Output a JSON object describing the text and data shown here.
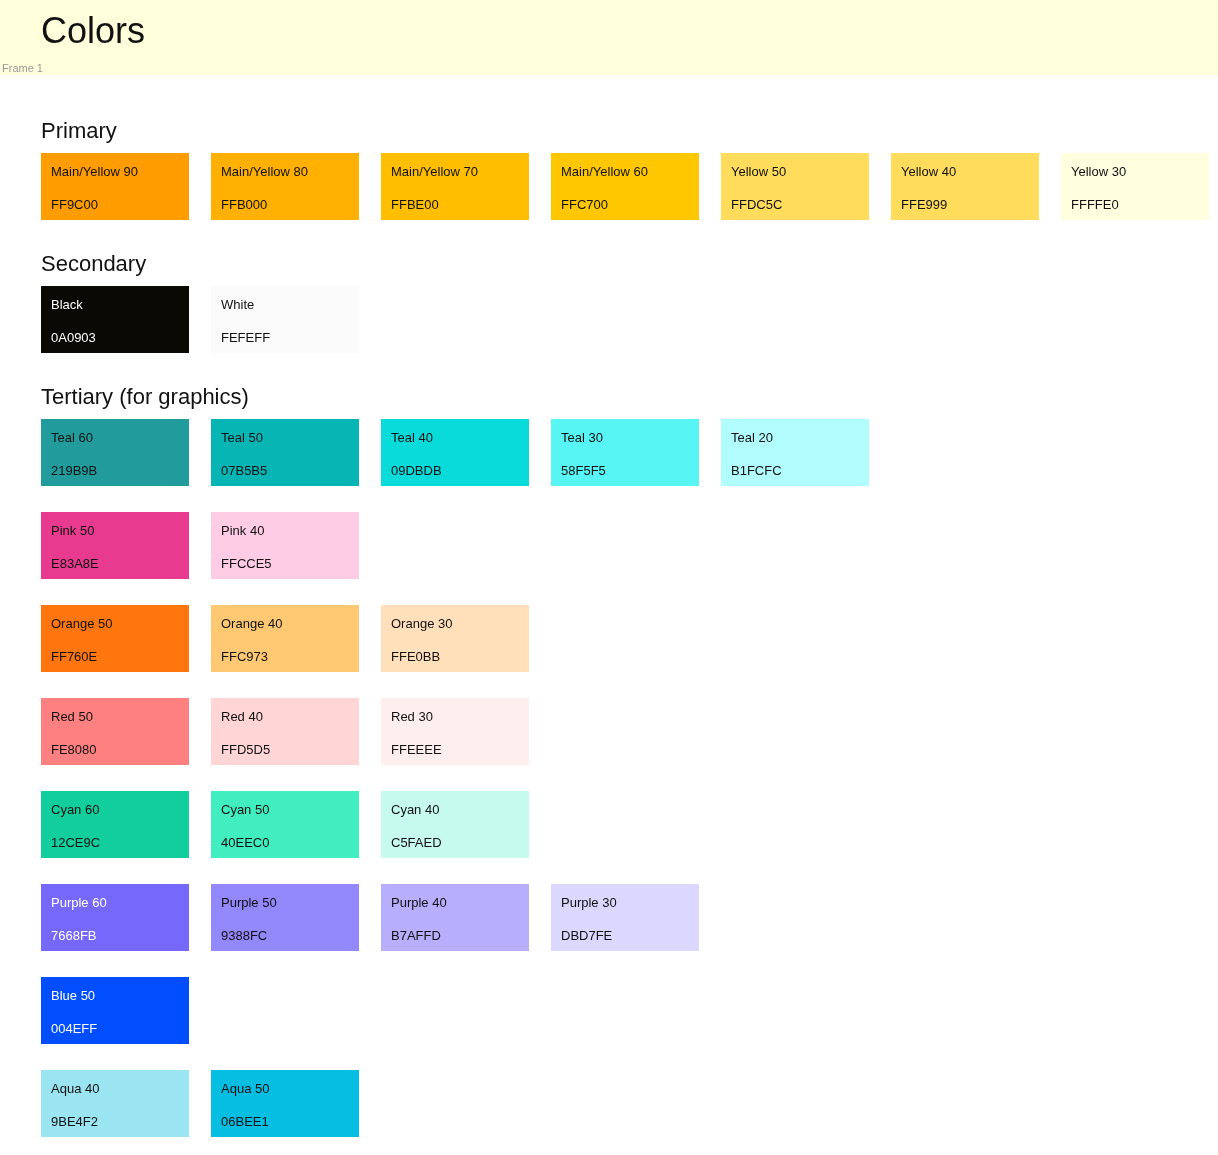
{
  "title": "Colors",
  "frame_label": "Frame 1",
  "sections": [
    {
      "heading": "Primary",
      "rows": [
        [
          {
            "name": "Main/Yellow 90",
            "hex": "FF9C00",
            "color": "#ff9c00",
            "light_text": false
          },
          {
            "name": "Main/Yellow 80",
            "hex": "FFB000",
            "color": "#ffb000",
            "light_text": false
          },
          {
            "name": "Main/Yellow 70",
            "hex": "FFBE00",
            "color": "#ffbe00",
            "light_text": false
          },
          {
            "name": "Main/Yellow 60",
            "hex": "FFC700",
            "color": "#ffc700",
            "light_text": false
          },
          {
            "name": "Yellow 50",
            "hex": "FFDC5C",
            "color": "#ffdc5c",
            "light_text": false
          },
          {
            "name": "Yellow 40",
            "hex": "FFE999",
            "color": "#ffdc5c",
            "light_text": false
          },
          {
            "name": "Yellow 30",
            "hex": "FFFFE0",
            "color": "#ffffe0",
            "light_text": false
          }
        ]
      ]
    },
    {
      "heading": "Secondary",
      "rows": [
        [
          {
            "name": "Black",
            "hex": "0A0903",
            "color": "#0a0903",
            "light_text": true
          },
          {
            "name": "White",
            "hex": "FEFEFF",
            "color": "#fafafa",
            "light_text": false
          }
        ]
      ]
    },
    {
      "heading": "Tertiary (for graphics)",
      "rows": [
        [
          {
            "name": "Teal 60",
            "hex": "219B9B",
            "color": "#219b9b",
            "light_text": false
          },
          {
            "name": "Teal 50",
            "hex": "07B5B5",
            "color": "#07b5b5",
            "light_text": false
          },
          {
            "name": "Teal 40",
            "hex": "09DBDB",
            "color": "#09dbdb",
            "light_text": false
          },
          {
            "name": "Teal 30",
            "hex": "58F5F5",
            "color": "#58f5f5",
            "light_text": false
          },
          {
            "name": "Teal 20",
            "hex": "B1FCFC",
            "color": "#b1fcfc",
            "light_text": false
          }
        ],
        [
          {
            "name": "Pink 50",
            "hex": "E83A8E",
            "color": "#e83a8e",
            "light_text": false
          },
          {
            "name": "Pink 40",
            "hex": "FFCCE5",
            "color": "#ffcce5",
            "light_text": false
          }
        ],
        [
          {
            "name": "Orange 50",
            "hex": "FF760E",
            "color": "#ff760e",
            "light_text": false
          },
          {
            "name": "Orange 40",
            "hex": "FFC973",
            "color": "#ffc973",
            "light_text": false
          },
          {
            "name": "Orange 30",
            "hex": "FFE0BB",
            "color": "#ffe0bb",
            "light_text": false
          }
        ],
        [
          {
            "name": "Red 50",
            "hex": "FE8080",
            "color": "#fe8080",
            "light_text": false
          },
          {
            "name": "Red 40",
            "hex": "FFD5D5",
            "color": "#ffd5d5",
            "light_text": false
          },
          {
            "name": "Red 30",
            "hex": "FFEEEE",
            "color": "#ffeeee",
            "light_text": false
          }
        ],
        [
          {
            "name": "Cyan 60",
            "hex": "12CE9C",
            "color": "#12ce9c",
            "light_text": false
          },
          {
            "name": "Cyan 50",
            "hex": "40EEC0",
            "color": "#40eec0",
            "light_text": false
          },
          {
            "name": "Cyan 40",
            "hex": "C5FAED",
            "color": "#c5faed",
            "light_text": false
          }
        ],
        [
          {
            "name": "Purple 60",
            "hex": "7668FB",
            "color": "#7668fb",
            "light_text": true
          },
          {
            "name": "Purple 50",
            "hex": "9388FC",
            "color": "#9388fc",
            "light_text": false
          },
          {
            "name": "Purple 40",
            "hex": "B7AFFD",
            "color": "#b7affd",
            "light_text": false
          },
          {
            "name": "Purple 30",
            "hex": "DBD7FE",
            "color": "#dbd7fe",
            "light_text": false
          }
        ],
        [
          {
            "name": "Blue 50",
            "hex": "004EFF",
            "color": "#004eff",
            "light_text": true
          }
        ],
        [
          {
            "name": "Aqua 40",
            "hex": "9BE4F2",
            "color": "#9be4f2",
            "light_text": false
          },
          {
            "name": "Aqua 50",
            "hex": "06BEE1",
            "color": "#06bee1",
            "light_text": false
          }
        ]
      ]
    }
  ]
}
